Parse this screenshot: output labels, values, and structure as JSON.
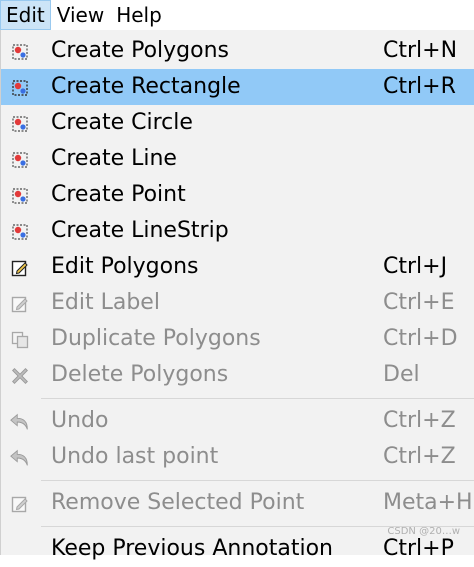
{
  "menubar": {
    "items": [
      {
        "label": "Edit",
        "active": true
      },
      {
        "label": "View",
        "active": false
      },
      {
        "label": "Help",
        "active": false
      }
    ]
  },
  "menu": {
    "items": [
      {
        "label": "Create Polygons",
        "shortcut": "Ctrl+N",
        "icon": "create-shape-icon",
        "enabled": true,
        "highlight": false
      },
      {
        "label": "Create Rectangle",
        "shortcut": "Ctrl+R",
        "icon": "create-shape-icon",
        "enabled": true,
        "highlight": true
      },
      {
        "label": "Create Circle",
        "shortcut": "",
        "icon": "create-shape-icon",
        "enabled": true,
        "highlight": false
      },
      {
        "label": "Create Line",
        "shortcut": "",
        "icon": "create-shape-icon",
        "enabled": true,
        "highlight": false
      },
      {
        "label": "Create Point",
        "shortcut": "",
        "icon": "create-shape-icon",
        "enabled": true,
        "highlight": false
      },
      {
        "label": "Create LineStrip",
        "shortcut": "",
        "icon": "create-shape-icon",
        "enabled": true,
        "highlight": false
      },
      {
        "label": "Edit Polygons",
        "shortcut": "Ctrl+J",
        "icon": "edit-icon",
        "enabled": true,
        "highlight": false
      },
      {
        "label": "Edit Label",
        "shortcut": "Ctrl+E",
        "icon": "edit-icon",
        "enabled": false,
        "highlight": false
      },
      {
        "label": "Duplicate Polygons",
        "shortcut": "Ctrl+D",
        "icon": "copy-icon",
        "enabled": false,
        "highlight": false
      },
      {
        "label": "Delete Polygons",
        "shortcut": "Del",
        "icon": "delete-icon",
        "enabled": false,
        "highlight": false
      },
      {
        "label": "Undo",
        "shortcut": "Ctrl+Z",
        "icon": "undo-icon",
        "enabled": false,
        "highlight": false
      },
      {
        "label": "Undo last point",
        "shortcut": "Ctrl+Z",
        "icon": "undo-icon",
        "enabled": false,
        "highlight": false
      },
      {
        "label": "Remove Selected Point",
        "shortcut": "Meta+H",
        "icon": "edit-icon",
        "enabled": false,
        "highlight": false
      },
      {
        "label": "Keep Previous Annotation",
        "shortcut": "Ctrl+P",
        "icon": "",
        "enabled": true,
        "highlight": false
      }
    ]
  },
  "watermark": "CSDN @20…w",
  "colors": {
    "highlight": "#91c9f7",
    "menu_bg": "#f2f2f2",
    "disabled_text": "#8d8d8d",
    "menubar_active": "#cce4f7"
  }
}
